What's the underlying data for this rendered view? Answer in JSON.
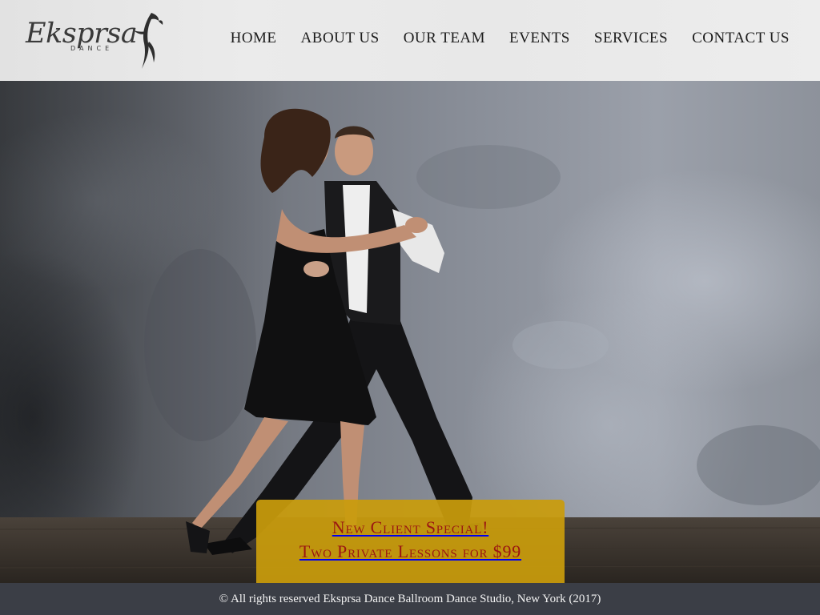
{
  "brand": {
    "name": "Eksprsa",
    "tagline": "DANCE"
  },
  "nav": {
    "items": [
      {
        "label": "HOME"
      },
      {
        "label": "ABOUT US"
      },
      {
        "label": "OUR TEAM"
      },
      {
        "label": "EVENTS"
      },
      {
        "label": "SERVICES"
      },
      {
        "label": "CONTACT US"
      }
    ]
  },
  "promo": {
    "line1": "New Client Special!",
    "line2": "Two Private Lessons for $99",
    "text_color": "#9b1712",
    "background_color": "#c99c0c"
  },
  "footer": {
    "text": "© All rights reserved Eksprsa Dance Ballroom Dance Studio, New York (2017)"
  },
  "colors": {
    "header_bg": "#e8e8e8",
    "footer_bg": "#3b3e46",
    "nav_text": "#1c1c1c"
  },
  "hero": {
    "image": "couple-dancing-tango-photo"
  }
}
